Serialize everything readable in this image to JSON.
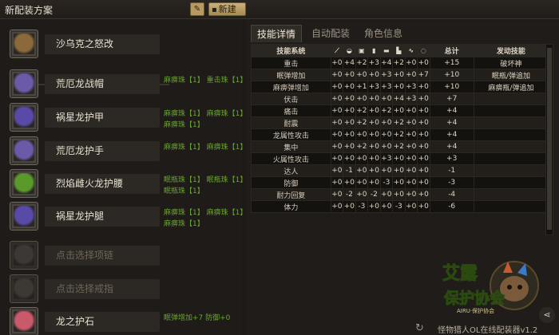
{
  "window": {
    "title": "新配装方案"
  },
  "toolbar": {
    "edit_icon": "pencil-icon",
    "new_label": "新建"
  },
  "slots": [
    {
      "name": "沙乌克之怒改",
      "icon": "weapon-icon",
      "color": "#8a6a3a",
      "deco1": "",
      "deco2": ""
    },
    {
      "name": "荒厄龙战帽",
      "icon": "helmet-icon",
      "color": "#6a5aa8",
      "deco1": "麻痹珠【1】  重击珠【1】",
      "deco2": ""
    },
    {
      "name": "祸星龙护甲",
      "icon": "chest-icon",
      "color": "#5a4aa8",
      "deco1": "麻痹珠【1】  麻痹珠【1】",
      "deco2": "麻痹珠【1】"
    },
    {
      "name": "荒厄龙护手",
      "icon": "gauntlet-icon",
      "color": "#6a5aa8",
      "deco1": "麻痹珠【1】  麻痹珠【1】",
      "deco2": ""
    },
    {
      "name": "烈焰雌火龙护腰",
      "icon": "waist-icon",
      "color": "#5a9a2a",
      "deco1": "眠瓶珠【1】  眠瓶珠【1】",
      "deco2": "眠瓶珠【1】"
    },
    {
      "name": "祸星龙护腿",
      "icon": "legs-icon",
      "color": "#5a4aa8",
      "deco1": "麻痹珠【1】  麻痹珠【1】",
      "deco2": "麻痹珠【1】"
    },
    {
      "name": "点击选择项链",
      "icon": "necklace-icon",
      "color": "#4a4640",
      "deco1": "",
      "deco2": ""
    },
    {
      "name": "点击选择戒指",
      "icon": "ring-icon",
      "color": "#4a4640",
      "deco1": "",
      "deco2": ""
    },
    {
      "name": "龙之护石",
      "icon": "talisman-icon",
      "color": "#c85a6a",
      "deco1": "眠弹增加+7  防御+0",
      "deco2": ""
    }
  ],
  "tabs": [
    "技能详情",
    "自动配装",
    "角色信息"
  ],
  "table": {
    "headers": [
      "技能系统",
      "weapon",
      "helmet",
      "chest",
      "arms",
      "waist",
      "legs",
      "necklace",
      "ring",
      "总计",
      "发动技能"
    ],
    "header_icons": [
      "",
      "⟋",
      "◒",
      "▣",
      "▮",
      "▬",
      "▙",
      "∿",
      "◌",
      "",
      ""
    ],
    "rows": [
      [
        "重击",
        "+0",
        "+4",
        "+2",
        "+3",
        "+4",
        "+2",
        "+0",
        "+0",
        "+15",
        "破坏神"
      ],
      [
        "眠弹增加",
        "+0",
        "+0",
        "+0",
        "+0",
        "+3",
        "+0",
        "+0",
        "+7",
        "+10",
        "眠瓶/弹追加"
      ],
      [
        "麻痹弹增加",
        "+0",
        "+0",
        "+1",
        "+3",
        "+3",
        "+0",
        "+3",
        "+0",
        "+10",
        "麻痹瓶/弹追加"
      ],
      [
        "伏击",
        "+0",
        "+0",
        "+0",
        "+0",
        "+0",
        "+4",
        "+3",
        "+0",
        "+7",
        ""
      ],
      [
        "痛击",
        "+0",
        "+0",
        "+2",
        "+0",
        "+2",
        "+0",
        "+0",
        "+0",
        "+4",
        ""
      ],
      [
        "耐震",
        "+0",
        "+0",
        "+2",
        "+0",
        "+0",
        "+2",
        "+0",
        "+0",
        "+4",
        ""
      ],
      [
        "龙属性攻击",
        "+0",
        "+0",
        "+0",
        "+0",
        "+0",
        "+2",
        "+0",
        "+0",
        "+4",
        ""
      ],
      [
        "集中",
        "+0",
        "+0",
        "+2",
        "+0",
        "+0",
        "+2",
        "+0",
        "+0",
        "+4",
        ""
      ],
      [
        "火属性攻击",
        "+0",
        "+0",
        "+0",
        "+0",
        "+3",
        "+0",
        "+0",
        "+0",
        "+3",
        ""
      ],
      [
        "达人",
        "+0",
        "-1",
        "+0",
        "+0",
        "+0",
        "+0",
        "+0",
        "+0",
        "-1",
        ""
      ],
      [
        "防御",
        "+0",
        "+0",
        "+0",
        "+0",
        "-3",
        "+0",
        "+0",
        "+0",
        "-3",
        ""
      ],
      [
        "耐力回复",
        "+0",
        "-2",
        "+0",
        "-2",
        "+0",
        "+0",
        "+0",
        "+0",
        "-4",
        ""
      ],
      [
        "体力",
        "+0",
        "+0",
        "-3",
        "+0",
        "+0",
        "-3",
        "+0",
        "+0",
        "-6",
        ""
      ]
    ]
  },
  "footer": {
    "text": "怪物猎人OL在线配装器v1.2",
    "refresh_icon": "refresh-icon",
    "share_icon": "share-icon"
  },
  "logo": {
    "line1": "艾露",
    "line2": "保护协会",
    "sub": "AIRU·保护协会"
  }
}
